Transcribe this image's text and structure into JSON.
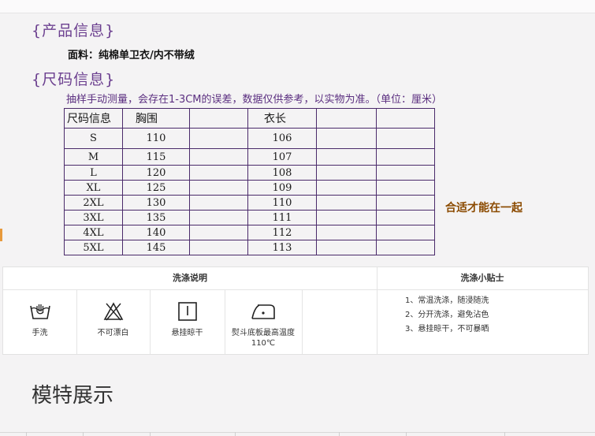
{
  "sections": {
    "product_info": "{产品信息}",
    "fabric": "面料：纯棉单卫衣/内不带绒",
    "size_info": "{尺码信息}",
    "note": "抽样手动测量，会存在1-3CM的误差，数据仅供参考，以实物为准。（单位：厘米）",
    "slogan": "合适才能在一起",
    "models": "模特展示"
  },
  "size_table": {
    "headers": [
      "尺码信息",
      "胸围",
      "",
      "衣长",
      "",
      ""
    ],
    "rows": [
      {
        "size": "S",
        "chest": "110",
        "length": "106"
      },
      {
        "size": "M",
        "chest": "115",
        "length": "107"
      },
      {
        "size": "L",
        "chest": "120",
        "length": "108"
      },
      {
        "size": "XL",
        "chest": "125",
        "length": "109"
      },
      {
        "size": "2XL",
        "chest": "130",
        "length": "110"
      },
      {
        "size": "3XL",
        "chest": "135",
        "length": "111"
      },
      {
        "size": "4XL",
        "chest": "140",
        "length": "112"
      },
      {
        "size": "5XL",
        "chest": "145",
        "length": "113"
      }
    ]
  },
  "wash": {
    "title": "洗涤说明",
    "tips_title": "洗涤小贴士",
    "items": [
      {
        "icon": "hand-wash-icon",
        "label": "手洗"
      },
      {
        "icon": "no-bleach-icon",
        "label": "不可漂白"
      },
      {
        "icon": "hang-dry-icon",
        "label": "悬挂晾干"
      },
      {
        "icon": "iron-icon",
        "label": "熨斗底板最高温度110℃"
      }
    ],
    "tips": [
      "1、常温洗涤，随浸随洗",
      "2、分开洗涤，避免沾色",
      "3、悬挂晾干，不可暴晒"
    ]
  }
}
